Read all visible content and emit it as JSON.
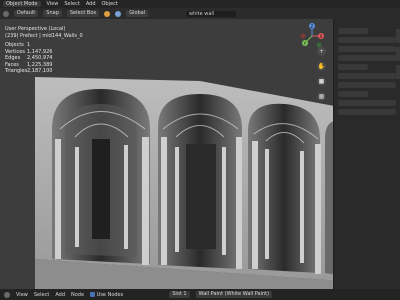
{
  "header": {
    "mode": "Object Mode",
    "menus": [
      "View",
      "Select",
      "Add",
      "Object"
    ]
  },
  "toolbar": {
    "shading": "Default",
    "snap": "Snap",
    "select_box": "Select Box",
    "orientation": "Global",
    "search": "white wall"
  },
  "overlay": {
    "perspective": "User Perspective (Local)",
    "object": "(239) Prefect | mid144_Walls_0",
    "stats": [
      {
        "key": "Objects",
        "value": "1"
      },
      {
        "key": "Vertices",
        "value": "1,147,926"
      },
      {
        "key": "Edges",
        "value": "2,450,974"
      },
      {
        "key": "Faces",
        "value": "1,225,389"
      },
      {
        "key": "Triangles",
        "value": "2,187,100"
      }
    ]
  },
  "gizmo": {
    "x": "X",
    "y": "Y",
    "z": "Z"
  },
  "statusbar": {
    "menus": [
      "View",
      "Select",
      "Add",
      "Node"
    ],
    "use_nodes": "Use Nodes",
    "slot": "Slot 1",
    "material": "Wall Paint (White Wall Paint)"
  }
}
